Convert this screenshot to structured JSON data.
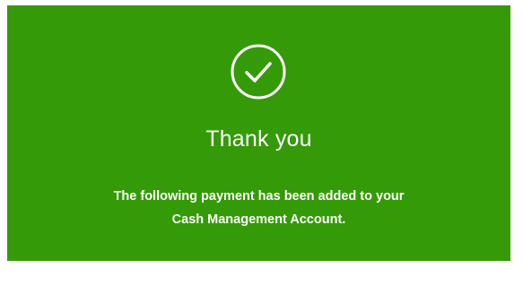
{
  "confirmation": {
    "icon": "check-circle-icon",
    "background_color": "#359a07",
    "text_color": "#ffffff",
    "title": "Thank you",
    "message_line_1": "The following payment has been added to your",
    "message_line_2": "Cash Management Account."
  }
}
